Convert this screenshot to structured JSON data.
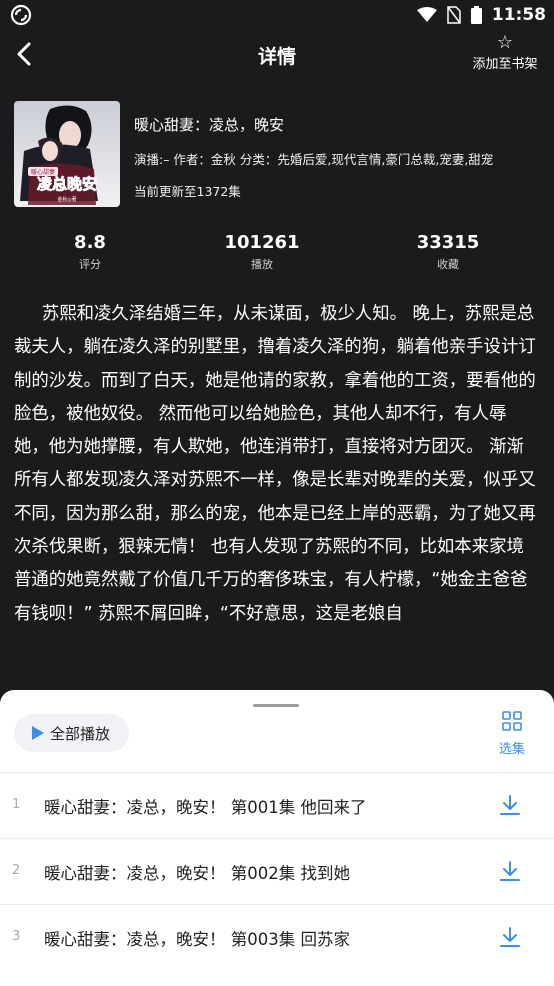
{
  "status_bar": {
    "time": "11:58"
  },
  "header": {
    "title": "详情",
    "add_shelf_label": "添加至书架"
  },
  "book": {
    "title": "暖心甜妻：凌总，晚安",
    "meta": "演播:–  作者：金秋  分类：先婚后爱,现代言情,豪门总裁,宠妻,甜宠",
    "update": "当前更新至1372集",
    "cover_title": "凌总晚安",
    "cover_badge": "暖心甜妻",
    "cover_author": "金秋◎著"
  },
  "stats": [
    {
      "value": "8.8",
      "label": "评分"
    },
    {
      "value": "101261",
      "label": "播放"
    },
    {
      "value": "33315",
      "label": "收藏"
    }
  ],
  "description": "苏熙和凌久泽结婚三年，从未谋面，极少人知。 晚上，苏熙是总裁夫人，躺在凌久泽的别墅里，撸着凌久泽的狗，躺着他亲手设计订制的沙发。而到了白天，她是他请的家教，拿着他的工资，要看他的脸色，被他奴役。 然而他可以给她脸色，其他人却不行，有人辱她，他为她撑腰，有人欺她，他连消带打，直接将对方团灭。 渐渐所有人都发现凌久泽对苏熙不一样，像是长辈对晚辈的关爱，似乎又不同，因为那么甜，那么的宠，他本是已经上岸的恶霸，为了她又再次杀伐果断，狠辣无情！ 也有人发现了苏熙的不同，比如本来家境普通的她竟然戴了价值几千万的奢侈珠宝，有人柠檬，“她金主爸爸有钱呗！” 苏熙不屑回眸，“不好意思，这是老娘自",
  "sheet": {
    "play_all_label": "全部播放",
    "select_label": "选集",
    "episodes": [
      {
        "num": "1",
        "title": "暖心甜妻：凌总，晚安！ 第001集 他回来了"
      },
      {
        "num": "2",
        "title": "暖心甜妻：凌总，晚安！ 第002集 找到她"
      },
      {
        "num": "3",
        "title": "暖心甜妻：凌总，晚安！ 第003集 回苏家"
      }
    ]
  },
  "colors": {
    "background": "#1b1b1d",
    "accent": "#3a8ee6",
    "sheet": "#ffffff"
  }
}
